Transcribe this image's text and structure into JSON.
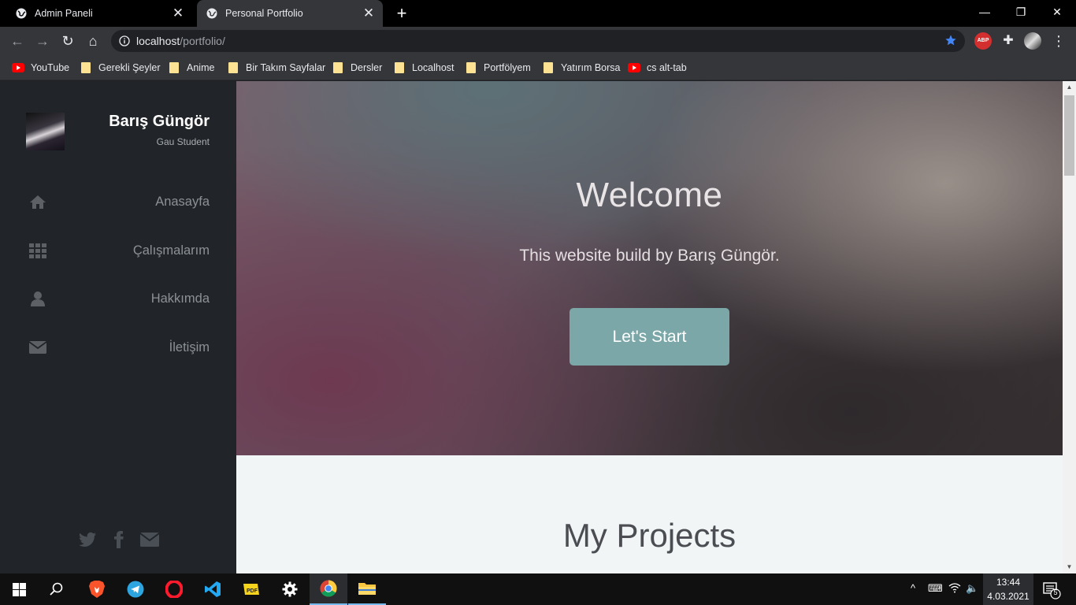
{
  "browser": {
    "tabs": [
      {
        "title": "Admin Paneli",
        "active": false
      },
      {
        "title": "Personal Portfolio",
        "active": true
      }
    ],
    "url": {
      "host": "localhost",
      "path": "/portfolio/"
    },
    "window_controls": {
      "minimize": "—",
      "restore": "❐",
      "close": "✕"
    },
    "bookmarks": [
      {
        "label": "YouTube",
        "icon": "youtube-icon"
      },
      {
        "label": "Gerekli Şeyler",
        "icon": "folder-icon"
      },
      {
        "label": "Anime",
        "icon": "folder-icon"
      },
      {
        "label": "Bir Takım Sayfalar",
        "icon": "folder-icon"
      },
      {
        "label": "Dersler",
        "icon": "folder-icon"
      },
      {
        "label": "Localhost",
        "icon": "folder-icon"
      },
      {
        "label": "Portfölyem",
        "icon": "folder-icon"
      },
      {
        "label": "Yatırım Borsa",
        "icon": "folder-icon"
      },
      {
        "label": "cs alt-tab",
        "icon": "youtube-icon"
      }
    ],
    "extensions": {
      "abp": "ABP"
    }
  },
  "sidebar": {
    "name": "Barış Güngör",
    "subtitle": "Gau Student",
    "menu": [
      {
        "label": "Anasayfa",
        "icon": "home-icon"
      },
      {
        "label": "Çalışmalarım",
        "icon": "grid-icon"
      },
      {
        "label": "Hakkımda",
        "icon": "user-icon"
      },
      {
        "label": "İletişim",
        "icon": "envelope-icon"
      }
    ],
    "social": [
      "twitter-icon",
      "facebook-icon",
      "envelope-icon"
    ]
  },
  "hero": {
    "title": "Welcome",
    "subtitle": "This website build by Barış Güngör.",
    "button": "Let's Start"
  },
  "projects": {
    "title": "My Projects"
  },
  "taskbar": {
    "apps": [
      "windows-start-icon",
      "search-icon",
      "brave-icon",
      "telegram-icon",
      "opera-icon",
      "vscode-icon",
      "pdf-icon",
      "settings-icon",
      "chrome-icon",
      "file-explorer-icon"
    ],
    "time": "13:44",
    "date": "4.03.2021",
    "notification_count": "5"
  },
  "colors": {
    "sidebar_bg": "#212529",
    "button_accent": "#7ba7a8",
    "projects_bg": "#f1f5f6",
    "bookmark_star": "#4285f4"
  }
}
